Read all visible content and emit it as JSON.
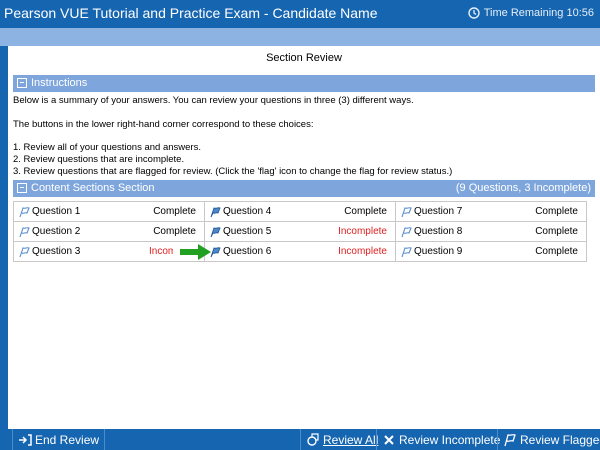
{
  "window": {
    "title": "Pearson VUE Tutorial and Practice Exam - Candidate Name",
    "timer": "Time Remaining 10:56"
  },
  "page": {
    "section_title": "Section Review"
  },
  "instructions": {
    "header": "Instructions",
    "line1": "Below is a summary of your answers. You can review your questions in three (3) different ways.",
    "line2": "The buttons in the lower right-hand corner correspond to these choices:",
    "line3": "1. Review all of your questions and answers.",
    "line4": "2. Review questions that are incomplete.",
    "line5": "3. Review questions that are flagged for review. (Click the 'flag' icon to change the flag for review status.)"
  },
  "content_section": {
    "header": "Content Sections Section",
    "summary": "(9 Questions, 3 Incomplete)",
    "questions": [
      {
        "label": "Question 1",
        "status": "Complete",
        "flag_icon": "flag-outline-icon"
      },
      {
        "label": "Question 4",
        "status": "Complete",
        "flag_icon": "flag-filled-icon"
      },
      {
        "label": "Question 7",
        "status": "Complete",
        "flag_icon": "flag-outline-icon"
      },
      {
        "label": "Question 2",
        "status": "Complete",
        "flag_icon": "flag-outline-icon"
      },
      {
        "label": "Question 5",
        "status": "Incomplete",
        "flag_icon": "flag-filled-icon"
      },
      {
        "label": "Question 8",
        "status": "Complete",
        "flag_icon": "flag-outline-icon"
      },
      {
        "label": "Question 3",
        "status": "Incomplete",
        "flag_icon": "flag-outline-icon"
      },
      {
        "label": "Question 6",
        "status": "Incomplete",
        "flag_icon": "flag-filled-icon"
      },
      {
        "label": "Question 9",
        "status": "Complete",
        "flag_icon": "flag-outline-icon"
      }
    ]
  },
  "footer": {
    "end_review": "End Review",
    "review_all": "Review All",
    "review_incomplete": "Review Incomplete",
    "review_flagged": "Review Flagged"
  },
  "colors": {
    "title_bar": "#1565b0",
    "sub_bar": "#8db3e2",
    "section_bar": "#7ea6dc",
    "incomplete_text": "#e02020",
    "arrow": "#22a022"
  }
}
